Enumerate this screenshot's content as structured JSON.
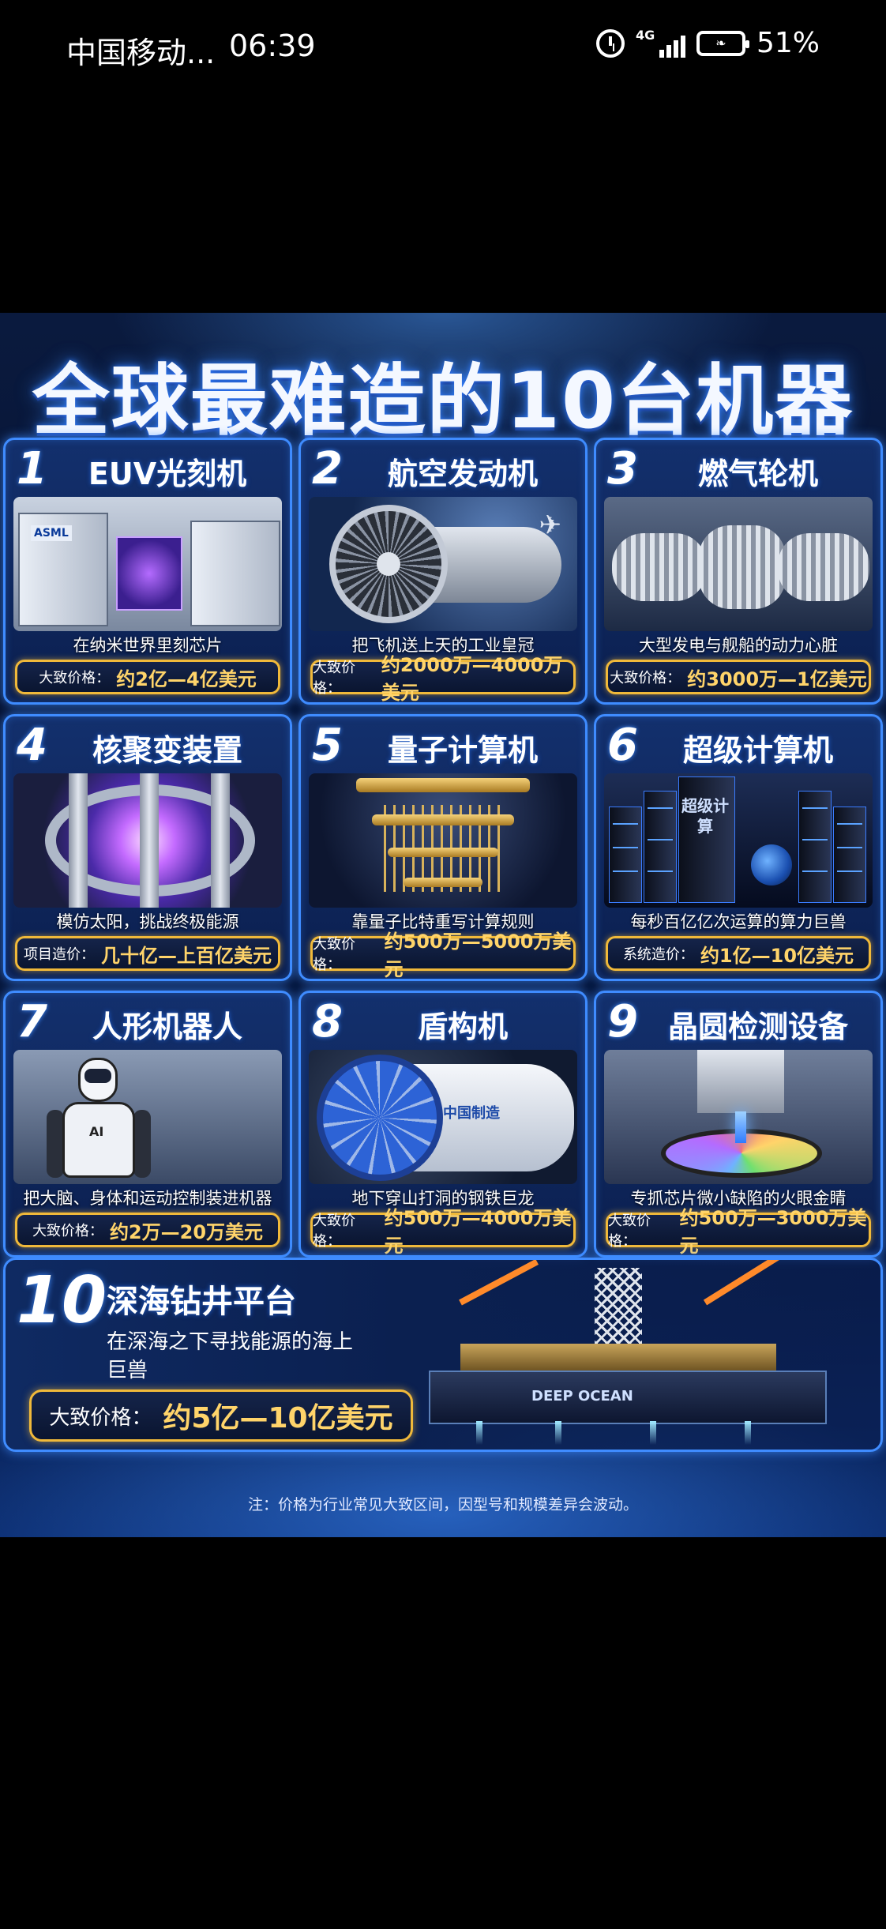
{
  "status_bar": {
    "carrier": "中国移动...",
    "time": "06:39",
    "network": "4G",
    "battery_percent": "51%"
  },
  "poster": {
    "title": "全球最难造的10台机器",
    "footnote": "注：价格为行业常见大致区间，因型号和规模差异会波动。",
    "cards": [
      {
        "num": "1",
        "title": "EUV光刻机",
        "desc": "在纳米世界里刻芯片",
        "price_label": "大致价格：",
        "price_value": "约2亿—4亿美元",
        "art_text": "ASML"
      },
      {
        "num": "2",
        "title": "航空发动机",
        "desc": "把飞机送上天的工业皇冠",
        "price_label": "大致价格：",
        "price_value": "约2000万—4000万美元"
      },
      {
        "num": "3",
        "title": "燃气轮机",
        "desc": "大型发电与舰船的动力心脏",
        "price_label": "大致价格：",
        "price_value": "约3000万—1亿美元"
      },
      {
        "num": "4",
        "title": "核聚变装置",
        "desc": "模仿太阳，挑战终极能源",
        "price_label": "项目造价：",
        "price_value": "几十亿—上百亿美元"
      },
      {
        "num": "5",
        "title": "量子计算机",
        "desc": "靠量子比特重写计算规则",
        "price_label": "大致价格：",
        "price_value": "约500万—5000万美元"
      },
      {
        "num": "6",
        "title": "超级计算机",
        "desc": "每秒百亿亿次运算的算力巨兽",
        "price_label": "系统造价：",
        "price_value": "约1亿—10亿美元",
        "art_text": "超级计算"
      },
      {
        "num": "7",
        "title": "人形机器人",
        "desc": "把大脑、身体和运动控制装进机器",
        "price_label": "大致价格：",
        "price_value": "约2万—20万美元",
        "art_text": "AI"
      },
      {
        "num": "8",
        "title": "盾构机",
        "desc": "地下穿山打洞的钢铁巨龙",
        "price_label": "大致价格：",
        "price_value": "约500万—4000万美元",
        "art_text": "中国制造"
      },
      {
        "num": "9",
        "title": "晶圆检测设备",
        "desc": "专抓芯片微小缺陷的火眼金睛",
        "price_label": "大致价格：",
        "price_value": "约500万—3000万美元"
      }
    ],
    "card10": {
      "num": "10",
      "title": "深海钻井平台",
      "desc": "在深海之下寻找能源的海上巨兽",
      "price_label": "大致价格：",
      "price_value": "约5亿—10亿美元",
      "art_text": "DEEP OCEAN"
    }
  }
}
